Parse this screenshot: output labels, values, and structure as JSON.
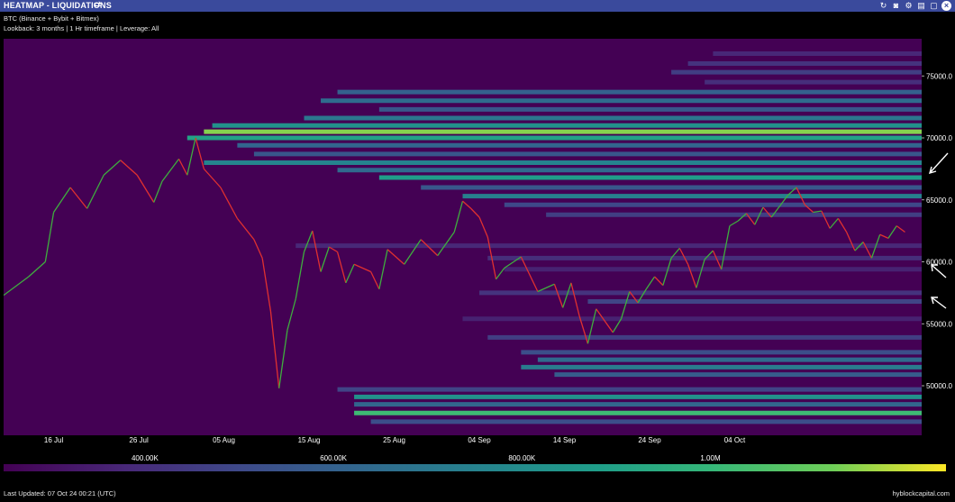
{
  "header": {
    "title": "HEATMAP - LIQUIDATIONS",
    "subtitle1": "BTC (Binance + Bybit + Bitmex)",
    "subtitle2": "Lookback: 3 months | 1 Hr timeframe | Leverage: All"
  },
  "footer": {
    "last_updated": "Last Updated: 07 Oct 24 00:21 (UTC)",
    "brand": "hyblockcapital.com"
  },
  "colors": {
    "titlebar": "#3a4a9c",
    "background": "#440154",
    "up": "#3fae3f",
    "down": "#e03030"
  },
  "chart_data": {
    "type": "heatmap",
    "y_ticks": [
      "75000.0",
      "70000.0",
      "65000.0",
      "60000.0",
      "55000.0",
      "50000.0"
    ],
    "ylim": [
      46000,
      78000
    ],
    "x_ticks": [
      "16 Jul",
      "26 Jul",
      "05 Aug",
      "15 Aug",
      "25 Aug",
      "04 Sep",
      "14 Sep",
      "24 Sep",
      "04 Oct"
    ],
    "colorbar_ticks": [
      "400.00K",
      "600.00K",
      "800.00K",
      "1.00M"
    ],
    "colorbar_range": [
      250000,
      1250000
    ],
    "price_path": [
      [
        0,
        57300
      ],
      [
        3,
        58800
      ],
      [
        5,
        60000
      ],
      [
        6,
        64000
      ],
      [
        8,
        66000
      ],
      [
        10,
        64300
      ],
      [
        12,
        67000
      ],
      [
        14,
        68200
      ],
      [
        16,
        67000
      ],
      [
        18,
        64800
      ],
      [
        19,
        66500
      ],
      [
        21,
        68300
      ],
      [
        22,
        67000
      ],
      [
        23,
        70000
      ],
      [
        24,
        67500
      ],
      [
        26,
        66000
      ],
      [
        28,
        63500
      ],
      [
        30,
        61800
      ],
      [
        31,
        60300
      ],
      [
        32,
        56000
      ],
      [
        33,
        49800
      ],
      [
        34,
        54500
      ],
      [
        35,
        57000
      ],
      [
        36,
        60800
      ],
      [
        37,
        62500
      ],
      [
        38,
        59200
      ],
      [
        39,
        61200
      ],
      [
        40,
        60800
      ],
      [
        41,
        58300
      ],
      [
        42,
        59800
      ],
      [
        44,
        59200
      ],
      [
        45,
        57800
      ],
      [
        46,
        61000
      ],
      [
        48,
        59800
      ],
      [
        50,
        61800
      ],
      [
        52,
        60500
      ],
      [
        54,
        62400
      ],
      [
        55,
        64900
      ],
      [
        56,
        64300
      ],
      [
        57,
        63600
      ],
      [
        58,
        62000
      ],
      [
        59,
        58600
      ],
      [
        60,
        59500
      ],
      [
        62,
        60400
      ],
      [
        64,
        57600
      ],
      [
        66,
        58200
      ],
      [
        67,
        56300
      ],
      [
        68,
        58300
      ],
      [
        69,
        55600
      ],
      [
        70,
        53400
      ],
      [
        71,
        56200
      ],
      [
        73,
        54300
      ],
      [
        74,
        55400
      ],
      [
        75,
        57600
      ],
      [
        76,
        56700
      ],
      [
        77,
        57800
      ],
      [
        78,
        58800
      ],
      [
        79,
        58100
      ],
      [
        80,
        60300
      ],
      [
        81,
        61100
      ],
      [
        82,
        59800
      ],
      [
        83,
        57900
      ],
      [
        84,
        60200
      ],
      [
        85,
        60900
      ],
      [
        86,
        59400
      ],
      [
        87,
        62900
      ],
      [
        88,
        63300
      ],
      [
        89,
        63900
      ],
      [
        90,
        63000
      ],
      [
        91,
        64400
      ],
      [
        92,
        63600
      ],
      [
        93,
        64500
      ],
      [
        94,
        65400
      ],
      [
        95,
        66000
      ],
      [
        96,
        64600
      ],
      [
        97,
        64000
      ],
      [
        98,
        64100
      ],
      [
        99,
        62700
      ],
      [
        100,
        63500
      ],
      [
        101,
        62400
      ],
      [
        102,
        60900
      ],
      [
        103,
        61600
      ],
      [
        104,
        60300
      ],
      [
        105,
        62200
      ],
      [
        106,
        61900
      ],
      [
        107,
        62900
      ],
      [
        108,
        62400
      ]
    ],
    "liquidation_bands": [
      {
        "price": 76800,
        "start": 85,
        "value": 380000
      },
      {
        "price": 76000,
        "start": 82,
        "value": 420000
      },
      {
        "price": 75300,
        "start": 80,
        "value": 460000
      },
      {
        "price": 74500,
        "start": 84,
        "value": 400000
      },
      {
        "price": 73700,
        "start": 40,
        "value": 600000
      },
      {
        "price": 73000,
        "start": 38,
        "value": 650000
      },
      {
        "price": 72300,
        "start": 45,
        "value": 560000
      },
      {
        "price": 71600,
        "start": 36,
        "value": 700000
      },
      {
        "price": 71000,
        "start": 25,
        "value": 820000
      },
      {
        "price": 70500,
        "start": 24,
        "value": 1150000
      },
      {
        "price": 70000,
        "start": 22,
        "value": 900000
      },
      {
        "price": 69400,
        "start": 28,
        "value": 620000
      },
      {
        "price": 68700,
        "start": 30,
        "value": 560000
      },
      {
        "price": 68000,
        "start": 24,
        "value": 760000
      },
      {
        "price": 67400,
        "start": 40,
        "value": 640000
      },
      {
        "price": 66800,
        "start": 45,
        "value": 880000
      },
      {
        "price": 66000,
        "start": 50,
        "value": 560000
      },
      {
        "price": 65300,
        "start": 55,
        "value": 740000
      },
      {
        "price": 64600,
        "start": 60,
        "value": 500000
      },
      {
        "price": 63800,
        "start": 65,
        "value": 460000
      },
      {
        "price": 61300,
        "start": 35,
        "value": 380000
      },
      {
        "price": 60300,
        "start": 58,
        "value": 400000
      },
      {
        "price": 59400,
        "start": 60,
        "value": 360000
      },
      {
        "price": 57500,
        "start": 57,
        "value": 420000
      },
      {
        "price": 56800,
        "start": 70,
        "value": 480000
      },
      {
        "price": 55400,
        "start": 55,
        "value": 360000
      },
      {
        "price": 53900,
        "start": 58,
        "value": 460000
      },
      {
        "price": 52700,
        "start": 62,
        "value": 520000
      },
      {
        "price": 52100,
        "start": 64,
        "value": 640000
      },
      {
        "price": 51500,
        "start": 62,
        "value": 720000
      },
      {
        "price": 50900,
        "start": 66,
        "value": 580000
      },
      {
        "price": 49700,
        "start": 40,
        "value": 480000
      },
      {
        "price": 49100,
        "start": 42,
        "value": 820000
      },
      {
        "price": 48500,
        "start": 42,
        "value": 620000
      },
      {
        "price": 47800,
        "start": 42,
        "value": 1020000
      },
      {
        "price": 47100,
        "start": 44,
        "value": 520000
      }
    ]
  }
}
